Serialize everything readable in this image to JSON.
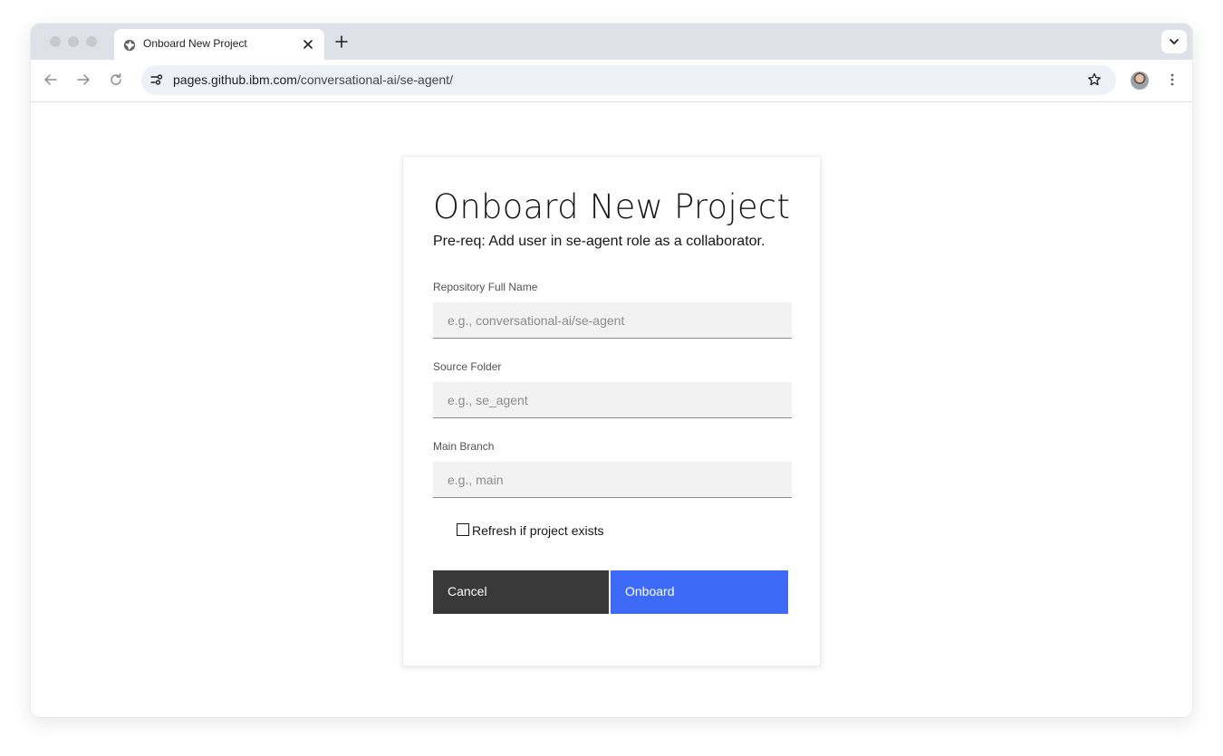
{
  "browser": {
    "tab_title": "Onboard New Project",
    "url_host": "pages.github.ibm.com",
    "url_path": "/conversational-ai/se-agent/",
    "icons": [
      "globe-icon",
      "close-icon",
      "plus-icon",
      "chevron-down-icon",
      "back-arrow-icon",
      "forward-arrow-icon",
      "reload-icon",
      "site-settings-icon",
      "star-icon",
      "profile-avatar",
      "more-vert-icon"
    ]
  },
  "form": {
    "title": "Onboard New Project",
    "subtitle": "Pre-req: Add user in se-agent role as a collaborator.",
    "repo": {
      "label": "Repository Full Name",
      "placeholder": "e.g., conversational-ai/se-agent",
      "value": ""
    },
    "source_folder": {
      "label": "Source Folder",
      "placeholder": "e.g., se_agent",
      "value": ""
    },
    "main_branch": {
      "label": "Main Branch",
      "placeholder": "e.g., main",
      "value": ""
    },
    "refresh_checkbox": {
      "label": "Refresh if project exists",
      "checked": false
    },
    "cancel_label": "Cancel",
    "onboard_label": "Onboard"
  },
  "colors": {
    "primary_button": "#3d6bf7",
    "secondary_button": "#393939",
    "input_background": "#f2f2f2",
    "tabstrip": "#dee1e8"
  }
}
